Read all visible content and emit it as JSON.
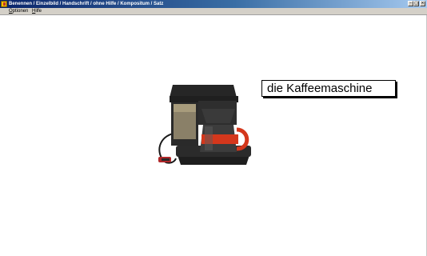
{
  "window": {
    "title": "Benennen / Einzelbild / Handschrift / ohne Hilfe / Kompositum / Satz",
    "icon": "app-icon",
    "controls": [
      "minimize-icon",
      "maximize-icon",
      "close-icon"
    ]
  },
  "menu": {
    "items": [
      {
        "accel": "O",
        "rest": "ptionen"
      },
      {
        "accel": "H",
        "rest": "ilfe"
      }
    ]
  },
  "exercise": {
    "word": "die Kaffeemaschine",
    "picture": "coffee-machine-image"
  },
  "colors": {
    "titlebar_start": "#0a246a",
    "titlebar_end": "#a6caf0",
    "menubar": "#d4d0c8",
    "accent_red": "#c0392b"
  }
}
